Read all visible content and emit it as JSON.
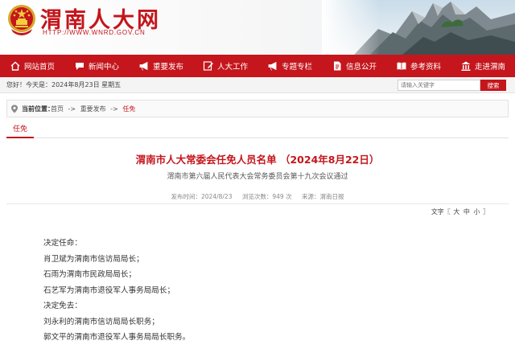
{
  "header": {
    "site_title": "渭南人大网",
    "site_url": "HTTP://WWW.WNRD.GOV.CN",
    "emblem_icon": "national-emblem-icon",
    "brand_color": "#c4161c"
  },
  "nav": {
    "items": [
      {
        "label": "网站首页",
        "icon": "home-icon"
      },
      {
        "label": "新闻中心",
        "icon": "chat-bubble-icon"
      },
      {
        "label": "重要发布",
        "icon": "megaphone-icon"
      },
      {
        "label": "人大工作",
        "icon": "pencil-icon"
      },
      {
        "label": "专题专栏",
        "icon": "megaphone-icon"
      },
      {
        "label": "信息公开",
        "icon": "document-icon"
      },
      {
        "label": "参考资料",
        "icon": "book-icon"
      },
      {
        "label": "走进渭南",
        "icon": "landmark-icon"
      }
    ]
  },
  "infobar": {
    "date_text": "您好！今天是：2024年8月23日 星期五",
    "search_placeholder": "请输入关键字",
    "search_button": "搜索"
  },
  "breadcrumb": {
    "label": "当前位置：",
    "items": [
      "首页",
      "->",
      "重要发布",
      "->",
      "任免"
    ]
  },
  "tab": {
    "label": "任免"
  },
  "article": {
    "title": "渭南市人大常委会任免人员名单 （2024年8月22日）",
    "subtitle": "渭南市第六届人民代表大会常务委员会第十九次会议通过",
    "meta": {
      "date": "发布时间：2024/8/23",
      "views": "浏览次数：949 次",
      "source": "来源：渭南日报"
    },
    "fontsize": {
      "label": "文字〖",
      "large": "大",
      "medium": "中",
      "small": "小",
      "close": "〗"
    },
    "paragraphs": [
      "决定任命：",
      "肖卫斌为渭南市信访局局长；",
      "石雨为渭南市民政局局长；",
      "石艺军为渭南市退役军人事务局局长；",
      "决定免去：",
      "刘永利的渭南市信访局局长职务；",
      "郭文平的渭南市退役军人事务局局长职务。"
    ]
  }
}
